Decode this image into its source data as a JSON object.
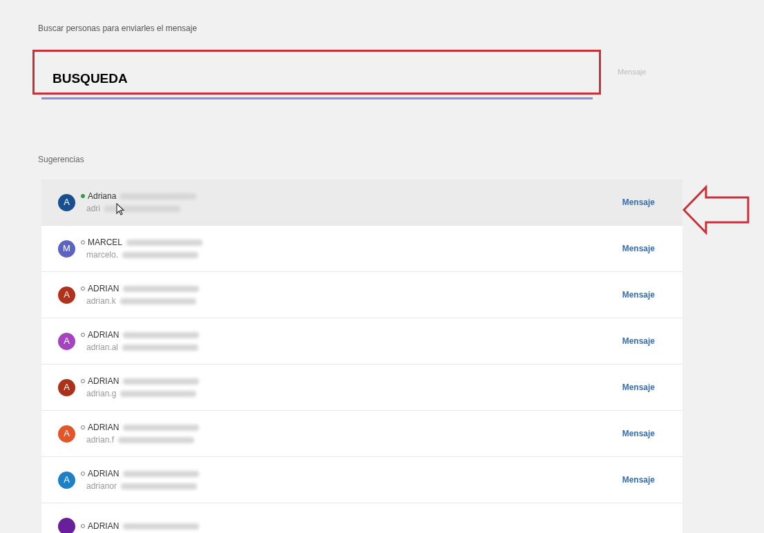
{
  "search": {
    "label": "Buscar personas para enviarles el mensaje",
    "value": "BUSQUEDA",
    "button": "Mensaje"
  },
  "suggestions_title": "Sugerencias",
  "people": [
    {
      "initial": "A",
      "color": "#1a4f8f",
      "online": true,
      "selected": true,
      "name": "Adriana",
      "email": "adri",
      "action": "Mensaje"
    },
    {
      "initial": "M",
      "color": "#5c64c0",
      "online": false,
      "selected": false,
      "name": "MARCEL",
      "email": "marcelo.",
      "action": "Mensaje"
    },
    {
      "initial": "A",
      "color": "#b0321c",
      "online": false,
      "selected": false,
      "name": "ADRIAN",
      "email": "adrian.k",
      "action": "Mensaje"
    },
    {
      "initial": "A",
      "color": "#a445c0",
      "online": false,
      "selected": false,
      "name": "ADRIAN",
      "email": "adrian.al",
      "action": "Mensaje"
    },
    {
      "initial": "A",
      "color": "#a8321b",
      "online": false,
      "selected": false,
      "name": "ADRIAN",
      "email": "adrian.g",
      "action": "Mensaje"
    },
    {
      "initial": "A",
      "color": "#e0572e",
      "online": false,
      "selected": false,
      "name": "ADRIAN",
      "email": "adrian.f",
      "action": "Mensaje"
    },
    {
      "initial": "A",
      "color": "#1f7fc4",
      "online": false,
      "selected": false,
      "name": "ADRIAN",
      "email": "adrianor",
      "action": "Mensaje"
    },
    {
      "color": "#6a1f9a",
      "online": false,
      "selected": false,
      "name": "ADRIAN"
    }
  ]
}
